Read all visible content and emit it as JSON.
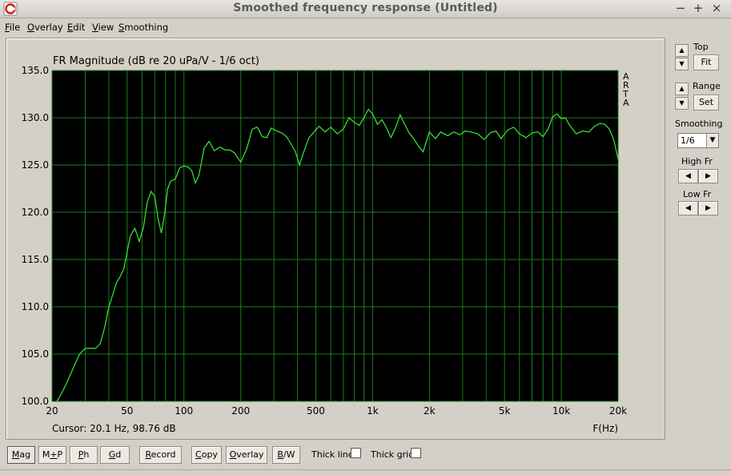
{
  "window": {
    "title": "Smoothed frequency response (Untitled)",
    "controls": [
      "−",
      "+",
      "×"
    ]
  },
  "menu": [
    {
      "pre": "",
      "u": "F",
      "post": "ile"
    },
    {
      "pre": "",
      "u": "O",
      "post": "verlay"
    },
    {
      "pre": "",
      "u": "E",
      "post": "dit"
    },
    {
      "pre": "",
      "u": "V",
      "post": "iew"
    },
    {
      "pre": "",
      "u": "S",
      "post": "moothing"
    }
  ],
  "chart_data": {
    "type": "line",
    "title": "FR Magnitude (dB re 20 uPa/V - 1/6 oct)",
    "xlabel": "F(Hz)",
    "ylabel": "",
    "xscale": "log",
    "xlim": [
      20,
      20000
    ],
    "ylim": [
      100,
      135
    ],
    "x_ticks": [
      20,
      50,
      100,
      200,
      500,
      1000,
      2000,
      5000,
      10000,
      20000
    ],
    "x_tick_labels": [
      "20",
      "50",
      "100",
      "200",
      "500",
      "1k",
      "2k",
      "5k",
      "10k",
      "20k"
    ],
    "y_ticks": [
      100,
      105,
      110,
      115,
      120,
      125,
      130,
      135
    ],
    "y_tick_labels": [
      "100.0",
      "105.0",
      "110.0",
      "115.0",
      "120.0",
      "125.0",
      "130.0",
      "135.0"
    ],
    "grid": true,
    "background": "#000000",
    "grid_color": "#1f7a1f",
    "line_color": "#33ee33",
    "watermark": "ARTA",
    "cursor_text": "Cursor: 20.1 Hz, 98.76 dB",
    "series": [
      {
        "x": [
          20,
          22,
          24,
          26,
          28,
          30,
          32,
          34,
          36,
          38,
          40,
          42,
          44,
          46,
          48,
          50,
          52,
          55,
          58,
          61,
          64,
          67,
          70,
          73,
          76,
          79,
          82,
          85,
          90,
          95,
          100,
          105,
          110,
          115,
          120,
          128,
          136,
          145,
          155,
          165,
          175,
          185,
          200,
          215,
          230,
          245,
          260,
          275,
          290,
          310,
          330,
          350,
          370,
          390,
          410,
          430,
          460,
          490,
          520,
          560,
          600,
          650,
          700,
          750,
          800,
          850,
          900,
          950,
          1000,
          1060,
          1120,
          1180,
          1250,
          1320,
          1400,
          1480,
          1560,
          1650,
          1750,
          1850,
          2000,
          2150,
          2300,
          2500,
          2700,
          2900,
          3100,
          3300,
          3600,
          3900,
          4200,
          4500,
          4800,
          5200,
          5600,
          6000,
          6500,
          7000,
          7500,
          8000,
          8500,
          9000,
          9500,
          10000,
          10500,
          11000,
          12000,
          13000,
          14000,
          15000,
          16000,
          17000,
          18000,
          19000,
          20000
        ],
        "values": [
          99.2,
          100.5,
          102.0,
          103.6,
          105.0,
          105.6,
          105.6,
          105.6,
          106.1,
          107.8,
          110.0,
          111.3,
          112.6,
          113.2,
          114.0,
          115.8,
          117.5,
          118.3,
          116.9,
          118.4,
          121.1,
          122.2,
          121.7,
          119.3,
          117.8,
          119.8,
          122.5,
          123.3,
          123.5,
          124.7,
          124.9,
          124.8,
          124.4,
          123.1,
          123.9,
          126.8,
          127.5,
          126.5,
          126.9,
          126.6,
          126.6,
          126.3,
          125.3,
          126.7,
          128.8,
          129.0,
          128.0,
          127.9,
          128.9,
          128.6,
          128.4,
          128.0,
          127.2,
          126.4,
          125.0,
          126.3,
          127.9,
          128.5,
          129.1,
          128.5,
          129.0,
          128.3,
          128.8,
          130.0,
          129.5,
          129.2,
          130.0,
          130.9,
          130.4,
          129.3,
          129.8,
          129.0,
          127.9,
          128.9,
          130.3,
          129.3,
          128.4,
          127.8,
          127.0,
          126.4,
          128.5,
          127.8,
          128.5,
          128.1,
          128.5,
          128.2,
          128.6,
          128.5,
          128.3,
          127.7,
          128.4,
          128.6,
          127.8,
          128.7,
          129.0,
          128.3,
          127.9,
          128.4,
          128.5,
          128.0,
          128.8,
          130.1,
          130.4,
          129.9,
          130.0,
          129.3,
          128.3,
          128.6,
          128.5,
          129.1,
          129.4,
          129.3,
          128.8,
          127.6,
          125.6
        ]
      }
    ]
  },
  "right_panel": {
    "top_label": "Top",
    "fit_label": "Fit",
    "range_label": "Range",
    "set_label": "Set",
    "smoothing_label": "Smoothing",
    "smoothing_value": "1/6",
    "highfr_label": "High Fr",
    "lowfr_label": "Low Fr"
  },
  "bottom": {
    "buttons": [
      {
        "pre": "",
        "u": "M",
        "post": "ag",
        "active": true
      },
      {
        "pre": "M",
        "u": "+",
        "post": "P",
        "active": false
      },
      {
        "pre": "",
        "u": "P",
        "post": "h",
        "active": false
      },
      {
        "pre": "",
        "u": "G",
        "post": "d",
        "active": false
      },
      {
        "pre": "",
        "u": "R",
        "post": "ecord",
        "active": false
      },
      {
        "pre": "",
        "u": "C",
        "post": "opy",
        "active": false
      },
      {
        "pre": "",
        "u": "O",
        "post": "verlay",
        "active": false
      },
      {
        "pre": "",
        "u": "B",
        "post": "/W",
        "active": false
      }
    ],
    "thick_line_label": "Thick line",
    "thick_grid_label": "Thick grid"
  }
}
